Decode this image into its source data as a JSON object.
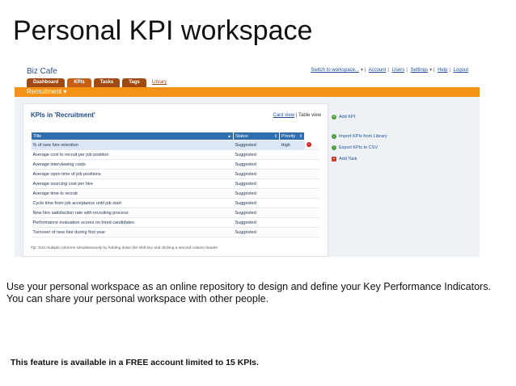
{
  "slide": {
    "title": "Personal KPI workspace",
    "description": "Use your personal workspace as an online repository to design and define your Key Performance Indicators. You can share your personal workspace with other people.",
    "note": "This feature is available in a FREE account limited to 15 KPIs."
  },
  "app": {
    "brand": "Biz Cafe",
    "top_nav": {
      "switch": "Switch to workspace...",
      "account": "Account",
      "users": "Users",
      "settings": "Settings",
      "help": "Help",
      "logout": "Logout"
    },
    "tabs": [
      {
        "label": "Dashboard"
      },
      {
        "label": "KPIs"
      },
      {
        "label": "Tasks"
      },
      {
        "label": "Tags"
      },
      {
        "label": "Library"
      }
    ],
    "workspace": "Recruitment",
    "content": {
      "title": "KPIs in 'Recruitment'",
      "view_card": "Card view",
      "view_table": "Table view",
      "columns": [
        "Title",
        "Status",
        "Priority"
      ],
      "rows": [
        {
          "title": "% of new hire retention",
          "status": "Suggested",
          "priority": "High"
        },
        {
          "title": "Average cost to recruit per job position",
          "status": "Suggested",
          "priority": ""
        },
        {
          "title": "Average interviewing costs",
          "status": "Suggested",
          "priority": ""
        },
        {
          "title": "Average open time of job positions",
          "status": "Suggested",
          "priority": ""
        },
        {
          "title": "Average sourcing cost per hire",
          "status": "Suggested",
          "priority": ""
        },
        {
          "title": "Average time to recruit",
          "status": "Suggested",
          "priority": ""
        },
        {
          "title": "Cycle time from job acceptance until job start",
          "status": "Suggested",
          "priority": ""
        },
        {
          "title": "New hire satisfaction rate with recruiting process",
          "status": "Suggested",
          "priority": ""
        },
        {
          "title": "Performance evaluation scores on hired candidates",
          "status": "Suggested",
          "priority": ""
        },
        {
          "title": "Turnover of new hire during first year",
          "status": "Suggested",
          "priority": ""
        }
      ],
      "tip": "Tip: Sort multiple columns simultaneously by holding down the shift key and clicking a second column header"
    },
    "sidebar": {
      "add_kpi": "Add KPI",
      "import_kpis": "Import KPIs from Library",
      "export_kpis": "Export KPIs to CSV",
      "add_task": "Add Task"
    }
  }
}
